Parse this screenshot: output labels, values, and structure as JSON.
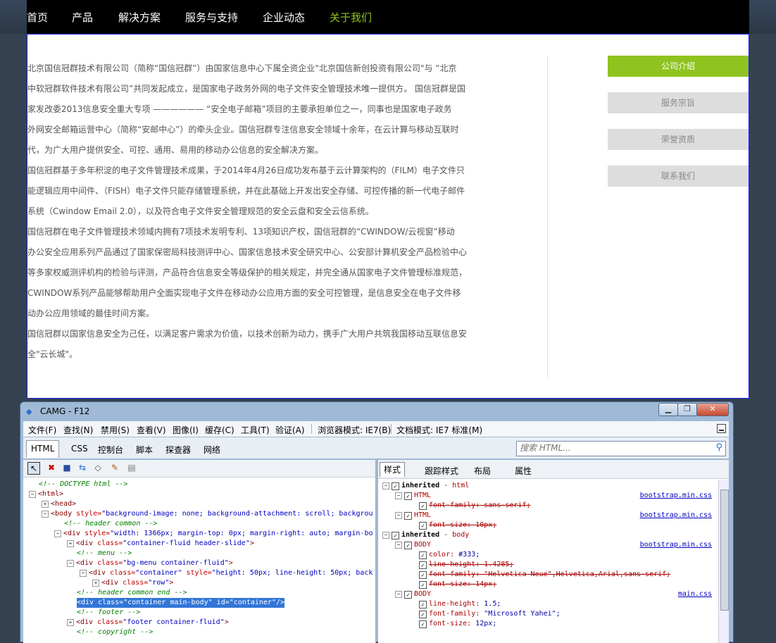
{
  "nav": {
    "items": [
      "首页",
      "产品",
      "解决方案",
      "服务与支持",
      "企业动态",
      "关于我们"
    ]
  },
  "article": {
    "paragraphs": [
      [
        "北京国信冠群技术有限公司（简称“国信冠群”）由国家信息中心下属全资企业\"北京国信新创投资有限公司\"与 “北京",
        "中软冠群软件技术有限公司”共同发起成立，是国家电子政务外网的电子文件安全管理技术唯一提供方。 国信冠群是国",
        "家发改委2013信息安全重大专项 ——————  “安全电子邮箱”项目的主要承担单位之一，同事也是国家电子政务",
        "外网安全邮箱运营中心（简称“安邮中心”）的牵头企业。国信冠群专注信息安全领域十余年，在云计算与移动互联时",
        "代，为广大用户提供安全、可控、通用、易用的移动办公信息的安全解决方案。"
      ],
      [
        "国信冠群基于多年积淀的电子文件管理技术成果，于2014年4月26日成功发布基于云计算架构的（FILM）电子文件只",
        "能逻辑应用中间件、（FISH）电子文件只能存储管理系统，并在此基础上开发出安全存储、可控传播的新一代电子邮件",
        "系统（Cwindow Email 2.0），以及符合电子文件安全管理规范的安全云盘和安全云信系统。"
      ],
      [
        "国信冠群在电子文件管理技术领域内拥有7项技术发明专利、13项知识产权，国信冠群的“CWINDOW/云视窗”移动",
        "办公安全应用系列产品通过了国家保密局科技测评中心、国家信息技术安全研究中心、公安部计算机安全产品检验中心",
        "等多家权威测评机构的检验与评测，产品符合信息安全等级保护的相关规定，并完全通从国家电子文件管理标准规范，",
        "CWINDOW系列产品能够帮助用户全面实现电子文件在移动办公应用方面的安全可控管理，是信息安全在电子文件移",
        "动办公应用领域的最佳时间方案。"
      ],
      [
        "国信冠群以国家信息安全为己任，以满足客户需求为价值，以技术创新为动力，携手广大用户共筑我国移动互联信息安",
        "全\"云长城\"。"
      ]
    ]
  },
  "sidemenu": {
    "items": [
      "公司介绍",
      "服务宗旨",
      "荣誉资质",
      "联系我们"
    ]
  },
  "devtools": {
    "title": "CAMG - F12",
    "menus": [
      "文件(F)",
      "查找(N)",
      "禁用(S)",
      "查看(V)",
      "图像(I)",
      "缓存(C)",
      "工具(T)",
      "验证(A)",
      "浏览器模式: IE7(B)",
      "文档模式: IE7 标准(M)"
    ],
    "tabs": [
      "HTML",
      "CSS",
      "控制台",
      "脚本",
      "探查器",
      "网络"
    ],
    "search_placeholder": "搜索 HTML...",
    "style_tabs": [
      "样式",
      "跟踪样式",
      "布局",
      "属性"
    ],
    "tree": {
      "r0": "<!-- DOCTYPE html -->",
      "r1": "<html>",
      "r2": "<head>",
      "r3a": "<body ",
      "r3b": "style=",
      "r3c": "\"background-image: none; background-attachment: scroll; backgrou",
      "r4": "<!-- header common -->",
      "r5a": "<div ",
      "r5b": "style=",
      "r5c": "\"width: 1366px; margin-top: 0px; margin-right: auto; margin-bo",
      "r6a": "<div ",
      "r6b": "class=",
      "r6c": "\"container-fluid header-slide\"",
      "r6d": ">",
      "r7": "<!-- menu -->",
      "r8a": "<div ",
      "r8b": "class=",
      "r8c": "\"bg-menu container-fluid\"",
      "r8d": ">",
      "r9a": "<div ",
      "r9b": "class=",
      "r9c": "\"container\"",
      "r9d": " style=",
      "r9e": "\"height: 50px; line-height: 50px; back",
      "r10a": "<div ",
      "r10b": "class=",
      "r10c": "\"row\"",
      "r10d": ">",
      "r11": "<!--  header common end -->",
      "r12": "<div class=\"container main-body\" id=\"container\"/>",
      "r13": "<!-- footer -->",
      "r14a": "<div ",
      "r14b": "class=",
      "r14c": "\"footer container-fluid\"",
      "r14d": ">",
      "r15": "<!-- copyright -->"
    },
    "rules": {
      "inh_html": "inherited",
      "inh_html_el": " - html",
      "html_tag": "HTML",
      "ff_ss": "font-family: sans-serif;",
      "fs_10": "font-size: 10px;",
      "inh_body": "inherited",
      "inh_body_el": " - body",
      "body_tag": "BODY",
      "color_name": "color: ",
      "color_val": "#333;",
      "lh_14285": "line-height: 1.4285;",
      "ff_helv": "font-family: \"Helvetica Neue\",Helvetica,Arial,sans-serif;",
      "fs_14": "font-size: 14px;",
      "lh_15_name": "line-height: ",
      "lh_15_val": "1.5;",
      "ff_yahei_name": "font-family: ",
      "ff_yahei_val": "\"Microsoft Yahei\";",
      "fs_12_name": "font-size: ",
      "fs_12_val": "12px;",
      "bootstrap": "bootstrap.min.css",
      "main": "main.css"
    }
  }
}
